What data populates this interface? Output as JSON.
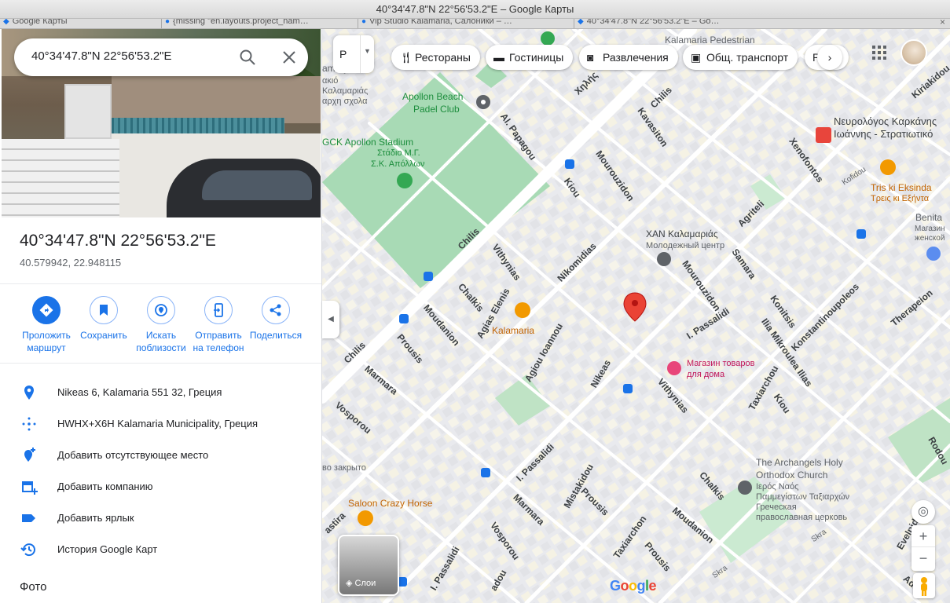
{
  "window": {
    "title": "40°34'47.8\"N 22°56'53.2\"E – Google Карты",
    "tabs": [
      "Google Карты",
      "{missing \"en.layouts.project_nam…",
      "Vip Studio Kalamaria, Салоники – …",
      "40°34'47.8\"N 22°56'53.2\"E – Go…"
    ]
  },
  "search": {
    "query": "40°34'47.8\"N 22°56'53.2\"E",
    "search_icon": "search-icon",
    "clear_icon": "close-icon"
  },
  "place": {
    "title": "40°34'47.8\"N 22°56'53.2\"E",
    "decimal": "40.579942, 22.948115",
    "actions": [
      {
        "label": "Проложить маршрут",
        "icon": "directions-icon"
      },
      {
        "label": "Сохранить",
        "icon": "bookmark-icon"
      },
      {
        "label": "Искать поблизости",
        "icon": "nearby-icon"
      },
      {
        "label": "Отправить на телефон",
        "icon": "send-to-phone-icon"
      },
      {
        "label": "Поделиться",
        "icon": "share-icon"
      }
    ],
    "info": [
      {
        "text": "Nikeas 6, Kalamaria 551 32, Греция",
        "icon": "location-pin-icon"
      },
      {
        "text": "HWHX+X6H Kalamaria Municipality, Греция",
        "icon": "plus-code-icon"
      },
      {
        "text": "Добавить отсутствующее место",
        "icon": "add-place-icon"
      },
      {
        "text": "Добавить компанию",
        "icon": "add-business-icon"
      },
      {
        "text": "Добавить ярлык",
        "icon": "label-icon"
      },
      {
        "text": "История Google Карт",
        "icon": "history-icon"
      }
    ],
    "photos_heading": "Фото"
  },
  "map": {
    "type_button": "Р",
    "chips": [
      {
        "label": "Рестораны",
        "icon": "restaurant-icon"
      },
      {
        "label": "Гостиницы",
        "icon": "hotel-icon"
      },
      {
        "label": "Развлечения",
        "icon": "camera-icon"
      },
      {
        "label": "Общ. транспорт",
        "icon": "transit-icon"
      },
      {
        "label": "Р",
        "icon": "parking-icon"
      }
    ],
    "layers_label": "Слои",
    "google_logo": "Google",
    "zoom_in": "+",
    "zoom_out": "−",
    "labels": {
      "pedestrian": "Kalamaria Pedestrian",
      "apollon_beach": "Apollon Beach",
      "padel": "Padel Club",
      "stadium": "GCK Apollon Stadium",
      "stadium_gr1": "Στάδιο Μ.Γ.",
      "stadium_gr2": "Σ.Κ. Απόλλων",
      "school1": "ακιό",
      "school2": "Καλαμαριάς",
      "school3": "αρχη σχολα",
      "school_top": "amary    ol",
      "neuro1": "Νευρολόγος Καρκάνης",
      "neuro2": "Ιωάννης - Στρατιωτικό",
      "tris1": "Tris ki Eksinda",
      "tris2": "Τρεις κι Εξήντα",
      "benita1": "Benita",
      "benita2": "Магазин",
      "benita3": "женской",
      "xan1": "ΧΑΝ Καλαμαριάς",
      "xan2": "Молодежный центр",
      "kalamaria": "Kalamaria",
      "shop1": "Магазин товаров",
      "shop2": "для дома",
      "archangels1": "The Archangels Holy",
      "archangels2": "Orthodox Church",
      "archangels3": "Ιερός Ναός",
      "archangels4": "Παμμεγίστων Ταξιαρχών",
      "archangels5": "Греческая",
      "archangels6": "православная церковь",
      "closed": "во закрыто",
      "saloon": "Saloon Crazy Horse",
      "kofidou": "Kofidou"
    },
    "streets": {
      "chilis_top": "Chilis",
      "chilis_gr": "Χηλής",
      "papagou": "Al. Papagou",
      "kavasiton": "Kavasiton",
      "kirgiakidou": "Kiriakidou",
      "xenofontos": "Xenofontos",
      "mourouzidon_top": "Mourouzidon",
      "kiou_top": "Kiou",
      "agriteli": "Agriteli",
      "chilis_mid": "Chilis",
      "vithynias_top": "Vithynias",
      "nikomidias": "Nikomidias",
      "mourouzidon_mid": "Mourouzidon",
      "samara": "Samara",
      "konitsis": "Konitsis",
      "konstantinoupoleos": "Konstantinoupoleos",
      "therapeion": "Therapeion",
      "chalkis_top": "Chalkis",
      "agias_elenis": "Agias Elenis",
      "agiou_ioannou": "Agiou Ioannou",
      "passalidi_mid": "I. Passalidi",
      "mikroulea": "Ilia Mikroulea Ilias",
      "moudanion_top": "Moudanion",
      "prousis_top": "Prousis",
      "nikeas": "Nikeas",
      "vithynias_mid": "Vithynias",
      "taxiarchou_top": "Taxiarchou",
      "kiou_mid": "Kiou",
      "chilis_left": "Chilis",
      "marmara_top": "Marmara",
      "vosporou_top": "Vosporou",
      "passalidi_low": "I. Passalidi",
      "mistakidou": "Mistakidou",
      "marmara_mid": "Marmara",
      "prousis_low": "Prousis",
      "chalkis_low": "Chalkis",
      "rodou": "Rodou",
      "eveipidou": "Evelpidou",
      "taxiarchon_low": "Taxiarchon",
      "moudanion_low": "Moudanion",
      "prousis_bot": "Prousis",
      "vosporou_low": "Vosporou",
      "passalidi_bot": "I. Passalidi",
      "zastira": "astira",
      "adou": "adou",
      "skra1": "Skra",
      "skra2": "Skra",
      "adra": "Adra"
    }
  }
}
